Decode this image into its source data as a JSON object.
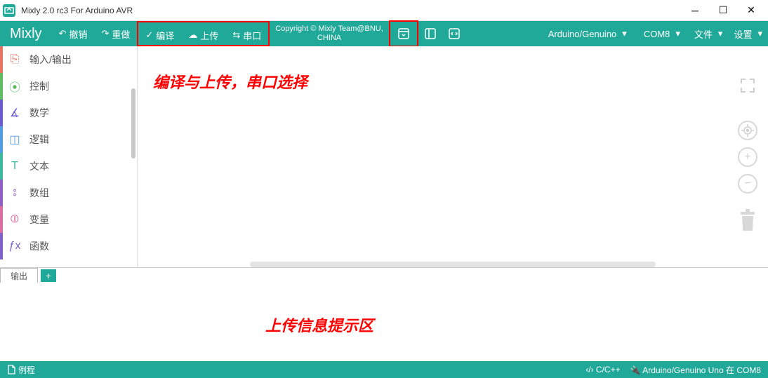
{
  "window": {
    "title": "Mixly 2.0 rc3 For Arduino AVR"
  },
  "toolbar": {
    "logo": "Mixly",
    "undo": "撤销",
    "redo": "重做",
    "compile": "编译",
    "upload": "上传",
    "serial": "串口",
    "copyright_line1": "Copyright © Mixly Team@BNU,",
    "copyright_line2": "CHINA",
    "board": "Arduino/Genuino",
    "port": "COM8",
    "file": "文件",
    "settings": "设置"
  },
  "categories": [
    {
      "label": "输入/输出",
      "color": "#e77361"
    },
    {
      "label": "控制",
      "color": "#5fbc60"
    },
    {
      "label": "数学",
      "color": "#6b5bd1"
    },
    {
      "label": "逻辑",
      "color": "#4f9de0"
    },
    {
      "label": "文本",
      "color": "#3bb99f"
    },
    {
      "label": "数组",
      "color": "#8f5ec3"
    },
    {
      "label": "变量",
      "color": "#d96da0"
    },
    {
      "label": "函数",
      "color": "#7d61c9"
    }
  ],
  "annotations": {
    "top": "编译与上传，串口选择",
    "bottom": "上传信息提示区"
  },
  "output": {
    "tab": "输出"
  },
  "statusbar": {
    "examples": "例程",
    "lang": "C/C++",
    "board_status": "Arduino/Genuino Uno 在 COM8"
  }
}
